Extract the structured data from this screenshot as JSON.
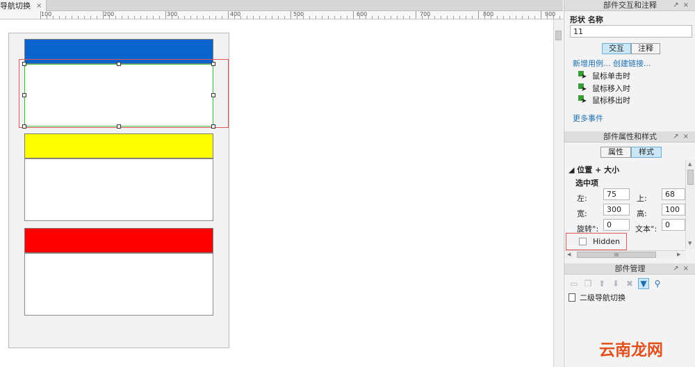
{
  "tab": {
    "label": "导航切换",
    "close": "×"
  },
  "ruler": {
    "labels": [
      "100",
      "200",
      "300",
      "400",
      "500",
      "600",
      "700",
      "800",
      "900"
    ]
  },
  "colors": {
    "blue_header": "#0b63ce",
    "yellow_header": "#ffff00",
    "red_header": "#ff0000",
    "selection": "#e05555",
    "body_border": "#36c236"
  },
  "interaction_panel": {
    "title": "部件交互和注释",
    "shape_label": "形状 名称",
    "name_value": "11",
    "tabs": [
      "交互",
      "注释"
    ],
    "links": "新增用例... 创建链接...",
    "events": [
      "鼠标单击时",
      "鼠标移入时",
      "鼠标移出时"
    ],
    "more_events": "更多事件"
  },
  "style_panel": {
    "title": "部件属性和样式",
    "tabs": [
      "属性",
      "样式"
    ],
    "section": "位置 + 大小",
    "selected": "选中项",
    "labels": {
      "left": "左:",
      "top": "上:",
      "width": "宽:",
      "height": "高:",
      "rotate": "旋转°:",
      "text": "文本°:"
    },
    "values": {
      "left": "75",
      "top": "68",
      "width": "300",
      "height": "100",
      "rotate": "0",
      "text": "0"
    },
    "hidden_label": "Hidden",
    "hscroll_grip": "III"
  },
  "manager_panel": {
    "title": "部件管理",
    "page_name": "二级导航切换"
  },
  "watermark": "云南龙网"
}
